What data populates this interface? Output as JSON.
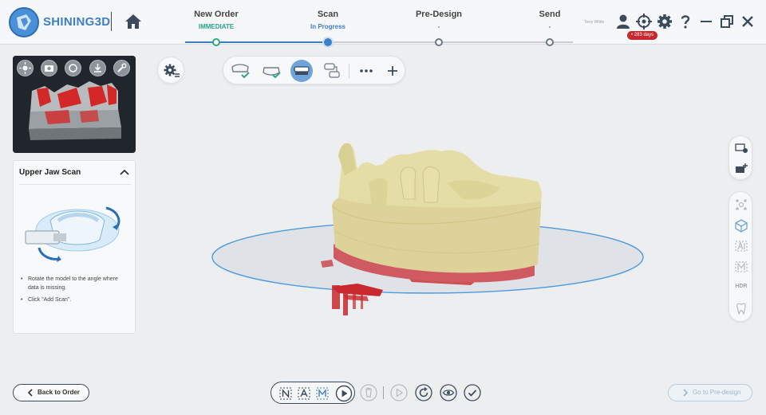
{
  "app": {
    "brand": "SHINING3D",
    "user_name": "Terry White",
    "license_badge": "• 283 days"
  },
  "steps": [
    {
      "title": "New Order",
      "status": "IMMEDIATE",
      "state": "done"
    },
    {
      "title": "Scan",
      "status": "In Progress",
      "state": "active"
    },
    {
      "title": "Pre-Design",
      "status": "-",
      "state": "pending"
    },
    {
      "title": "Send",
      "status": "-",
      "state": "pending"
    }
  ],
  "colors": {
    "accent": "#3d7fc6",
    "done": "#2aa58a",
    "badge": "#c8282e",
    "model": "#e2dba0",
    "model_base": "#d06068",
    "scan_data": "#c8282e"
  },
  "guide": {
    "title": "Upper Jaw Scan",
    "instructions": [
      "Rotate the model to the angle where data is missing.",
      "Click \"Add Scan\"."
    ]
  },
  "toolbar": {
    "items": [
      "upper-jaw-scan-done",
      "lower-jaw-scan-done",
      "base-scan-active",
      "align-scan",
      "more",
      "add"
    ]
  },
  "right_tools": {
    "group1": [
      "scan-settings-icon",
      "add-scan-icon"
    ],
    "group2": [
      "molecule-icon",
      "cube-icon",
      "ai-icon",
      "merge-icon",
      "hdr-icon",
      "tooth-icon"
    ],
    "hdr_label": "HDR"
  },
  "bottom": {
    "back_label": "Back to Order",
    "next_label": "Go to Pre-design",
    "group_letters": [
      "N",
      "A",
      "M"
    ]
  }
}
